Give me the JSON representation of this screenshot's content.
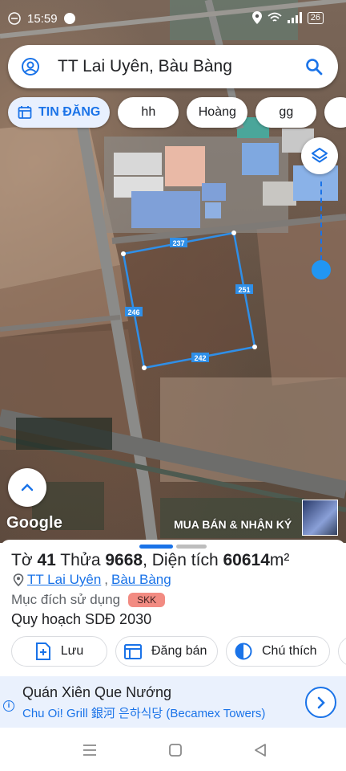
{
  "status": {
    "time": "15:59",
    "battery": "26"
  },
  "search": {
    "title": "TT Lai Uyên, Bàu Bàng"
  },
  "chips": {
    "primary": "TIN ĐĂNG",
    "items": [
      "hh",
      "Hoàng",
      "gg"
    ]
  },
  "map": {
    "edges": {
      "top": "237",
      "right": "251",
      "bottom": "242",
      "left": "246"
    },
    "logo": "Google",
    "label": "MUA BÁN & NHẬN KÝ"
  },
  "sheet": {
    "parcel": {
      "prefix": "Tờ",
      "sheet_no": "41",
      "plot_label": "Thửa",
      "plot_no": "9668",
      "area_label": "Diện tích",
      "area": "60614",
      "unit": "m²"
    },
    "location": {
      "town": "TT Lai Uyên",
      "sep": ",",
      "district": "Bàu Bàng"
    },
    "purpose": {
      "label": "Mục đích sử dụng",
      "code": "SKK"
    },
    "plan": "Quy hoạch SDĐ 2030",
    "actions": {
      "save": "Lưu",
      "post": "Đăng bán",
      "legend": "Chú thích"
    }
  },
  "ad": {
    "title": "Quán Xiên Que Nướng",
    "subtitle": "Chu Oi! Grill 銀河 은하식당 (Becamex Towers)"
  },
  "colors": {
    "accent": "#1a73e8",
    "parcel_outline": "#2f8fe8",
    "badge": "#f28b82",
    "ad_bg": "#eaf1fd"
  }
}
